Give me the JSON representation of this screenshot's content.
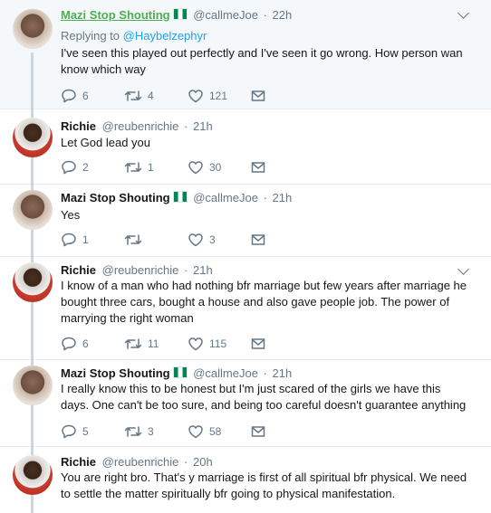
{
  "tweets": [
    {
      "name": "Mazi Stop Shouting",
      "handle": "@callmeJoe",
      "time": "22h",
      "replying_prefix": "Replying to",
      "replying_to": "@Haybelzephyr",
      "text": "I've seen this played out perfectly and I've seen it go wrong. How person wan know which way",
      "replies": "6",
      "retweets": "4",
      "likes": "121"
    },
    {
      "name": "Richie",
      "handle": "@reubenrichie",
      "time": "21h",
      "text": "Let God lead you",
      "replies": "2",
      "retweets": "1",
      "likes": "30"
    },
    {
      "name": "Mazi Stop Shouting",
      "handle": "@callmeJoe",
      "time": "21h",
      "text": "Yes",
      "replies": "1",
      "retweets": "",
      "likes": "3"
    },
    {
      "name": "Richie",
      "handle": "@reubenrichie",
      "time": "21h",
      "text": "I know of a man who had nothing bfr marriage but few years after marriage he bought three cars, bought a house and also gave people job. The power of marrying the right woman",
      "replies": "6",
      "retweets": "11",
      "likes": "115"
    },
    {
      "name": "Mazi Stop Shouting",
      "handle": "@callmeJoe",
      "time": "21h",
      "text": "I really know this to be honest but I'm just scared of the girls we have this days. One can't be too sure, and being too careful doesn't guarantee anything",
      "replies": "5",
      "retweets": "3",
      "likes": "58"
    },
    {
      "name": "Richie",
      "handle": "@reubenrichie",
      "time": "20h",
      "text": "You are right bro. That's y marriage is first of all spiritual bfr physical. We need to settle the matter spiritually bfr going to physical manifestation."
    }
  ],
  "separator": "·",
  "colors": {
    "link": "#1da1f2",
    "muted": "#657786",
    "thread": "#ccd6dd",
    "name_highlight": "#4caf50"
  },
  "icons": [
    "reply-icon",
    "retweet-icon",
    "like-icon",
    "mail-icon",
    "chevron-down-icon",
    "nigeria-flag-icon"
  ]
}
